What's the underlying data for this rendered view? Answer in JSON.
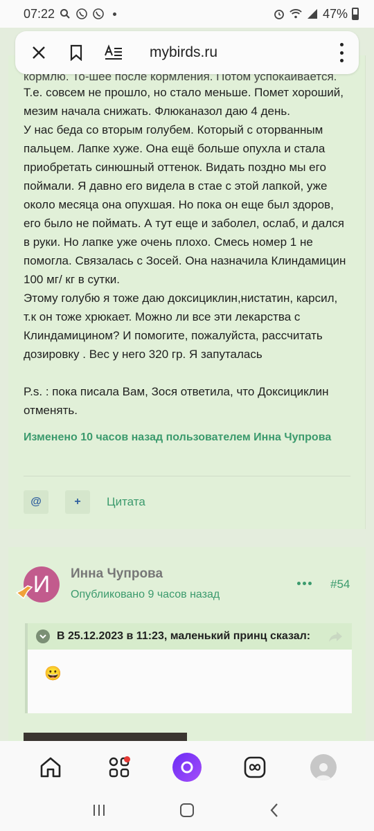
{
  "status_bar": {
    "time": "07:22",
    "battery": "47%"
  },
  "browser": {
    "url": "mybirds.ru"
  },
  "post": {
    "cut_line": "кормлю. То-шее после кормления. Потом успокаивается.",
    "lines": [
      "Т.е. совсем не прошло,  но стало меньше. Помет хороший,",
      "мезим начала снижать. Флюканазол даю 4 день.",
      "У нас беда со вторым голубем.  Который с оторванным",
      "пальцем.  Лапке хуже. Она ещё больше опухла и стала",
      "приобретать синюшный оттенок. Видать поздно мы его",
      "поймали. Я давно его видела в стае с этой лапкой, уже",
      "около месяца она опухшая. Но пока он еще был здоров,",
      "его было не поймать. А тут еще и заболел, ослаб, и дался",
      "в руки. Но лапке уже очень плохо.  Смесь номер 1 не",
      "помогла. Связалась с Зосей. Она назначила Клиндамицин",
      "100 мг/ кг в сутки.",
      "Этому голубю я тоже даю доксициклин,нистатин, карсил,",
      "т.к  он тоже хрюкает.  Можно ли все эти лекарства с",
      "Клиндамицином? И помогите, пожалуйста,  рассчитать",
      "дозировку . Вес у него 320 гр. Я запуталась"
    ],
    "ps_lines": [
      "P.s. : пока писала Вам, Зося ответила, что Доксициклин",
      "отменять."
    ],
    "edited_note": "Изменено 10 часов назад пользователем Инна Чупрова",
    "mention_label": "@",
    "add_label": "+",
    "quote_label": "Цитата"
  },
  "reply": {
    "avatar_letter": "И",
    "author": "Инна Чупрова",
    "published": "Опубликовано 9 часов назад",
    "post_number": "#54",
    "quote_header": "В 25.12.2023 в 11:23, маленький принц сказал:",
    "quote_body": "😀"
  },
  "colors": {
    "accent_green": "#3b9a6d",
    "card_bg": "#e1f0d8",
    "avatar": "#c25b8d"
  }
}
